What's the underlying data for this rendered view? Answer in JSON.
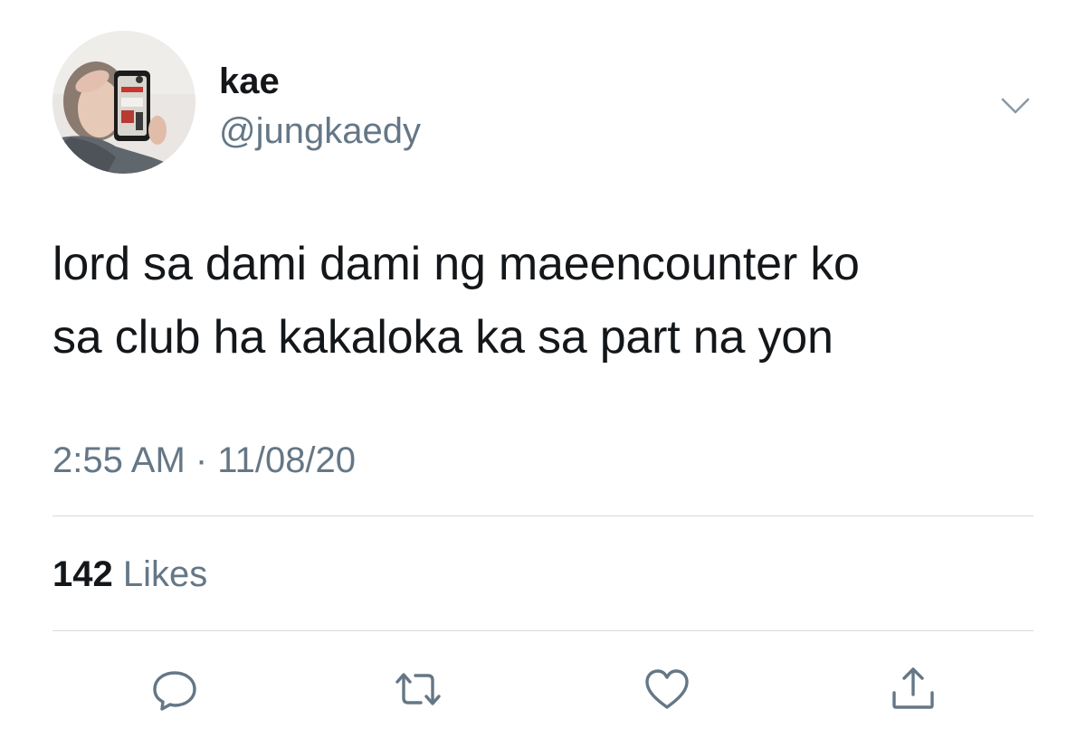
{
  "user": {
    "display_name": "kae",
    "handle": "@jungkaedy",
    "avatar_icon": "avatar"
  },
  "header": {
    "more_icon": "chevron-down-icon"
  },
  "tweet": {
    "lines": [
      "lord sa dami dami ng maeencounter ko",
      "sa club ha kakaloka ka sa part na yon"
    ],
    "timestamp": "2:55 AM · 11/08/20"
  },
  "stats": {
    "likes_count": "142",
    "likes_label": "Likes"
  },
  "actions": [
    {
      "name": "reply",
      "icon": "reply-icon"
    },
    {
      "name": "retweet",
      "icon": "retweet-icon"
    },
    {
      "name": "like",
      "icon": "heart-icon"
    },
    {
      "name": "share",
      "icon": "share-icon"
    }
  ],
  "colors": {
    "text_primary": "#14171a",
    "text_secondary": "#657786",
    "divider": "#d4d9dd"
  }
}
